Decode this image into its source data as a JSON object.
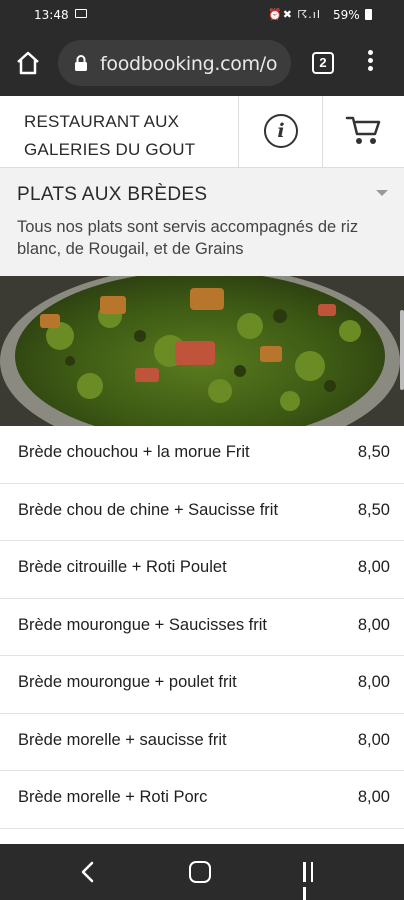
{
  "status_bar": {
    "time": "13:48",
    "icons": "⏰✖ ☈.ıl",
    "battery": "59%"
  },
  "browser": {
    "url": "foodbooking.com/o",
    "tab_count": "2"
  },
  "restaurant": {
    "name_line1": "RESTAURANT AUX",
    "name_line2": "GALERIES DU GOUT"
  },
  "category": {
    "title": "PLATS AUX BRÈDES",
    "description": "Tous nos plats sont servis accompagnés de riz blanc, de Rougail, et de Grains"
  },
  "dishes": [
    {
      "name": "Brède chouchou + la morue Frit",
      "price": "8,50"
    },
    {
      "name": "Brède chou de chine + Saucisse frit",
      "price": "8,50"
    },
    {
      "name": "Brède citrouille + Roti Poulet",
      "price": "8,00"
    },
    {
      "name": "Brède mourongue + Saucisses frit",
      "price": "8,00"
    },
    {
      "name": "Brède mourongue + poulet frit",
      "price": "8,00"
    },
    {
      "name": "Brède morelle + saucisse frit",
      "price": "8,00"
    },
    {
      "name": "Brède morelle + Roti Porc",
      "price": "8,00"
    }
  ],
  "colors": {
    "system_bar": "#2b2b2b",
    "url_pill": "#3c3c3c",
    "category_bg": "#f2f2f2"
  }
}
